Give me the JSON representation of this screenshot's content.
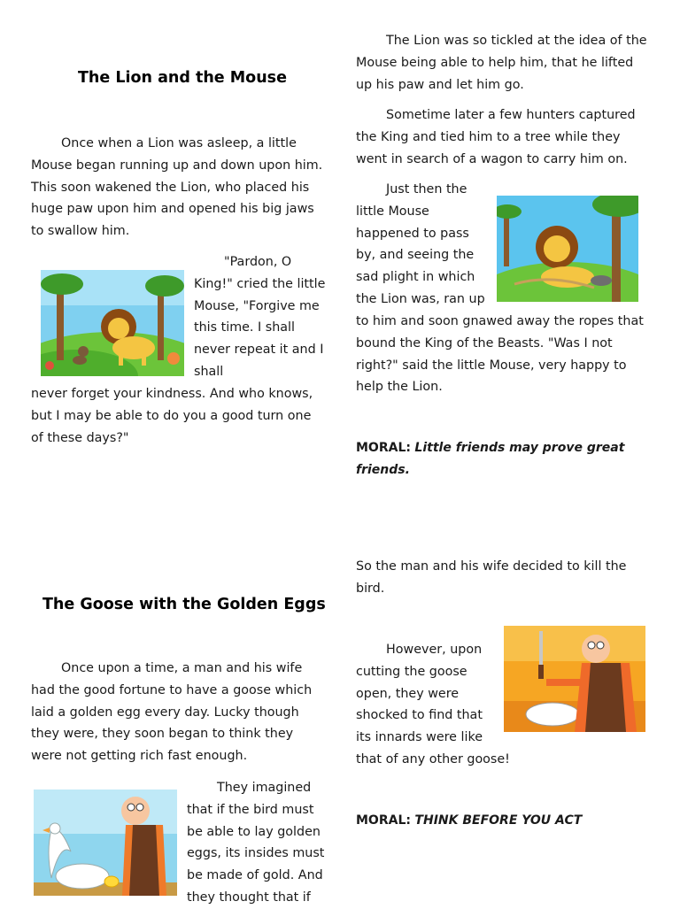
{
  "story1": {
    "title": "The Lion and the Mouse",
    "p1": "Once when a Lion was asleep, a little Mouse began running up and down upon him. This soon wakened the Lion, who placed his huge paw upon him and opened his big jaws to swallow him.",
    "p2_wrap": "\"Pardon, O King!\" cried the little Mouse, \"Forgive me this time. I shall never repeat it and I shall",
    "p2_full": "never forget your kindness. And who knows, but I may be able to do you a good turn one of these days?\"",
    "p3": "The Lion was so tickled at the idea of the Mouse being able to help him, that he lifted up his paw and let him go.",
    "p4": "Sometime later a few hunters captured the King and tied him to a tree while they went in search of a wagon to carry him on.",
    "p5_wrap": "Just then the little Mouse happened to pass by, and seeing the sad plight in which the Lion was, ran up",
    "p5_full": "to him and soon gnawed away the ropes that bound the King of the Beasts. \"Was I not right?\" said the little Mouse, very happy to help the Lion.",
    "moral_label": "MORAL:",
    "moral_text": "Little friends may prove great friends."
  },
  "story2": {
    "title": "The Goose with the Golden Eggs",
    "p1": "Once upon a time, a man and his wife had the good fortune to have a goose which laid a golden egg every day. Lucky though they were, they soon began to think they were not getting rich fast enough.",
    "p2_wrap": "They imagined that if the bird must be able to lay golden eggs, its insides must be made of gold. And they thought that if",
    "p3": "So the man and his wife decided to kill the bird.",
    "p4_wrap": "However, upon cutting the goose open, they were shocked to find that its innards were like",
    "p4_full": "that of any other goose!",
    "moral_label": "MORAL:",
    "moral_text": "THINK BEFORE YOU ACT"
  }
}
